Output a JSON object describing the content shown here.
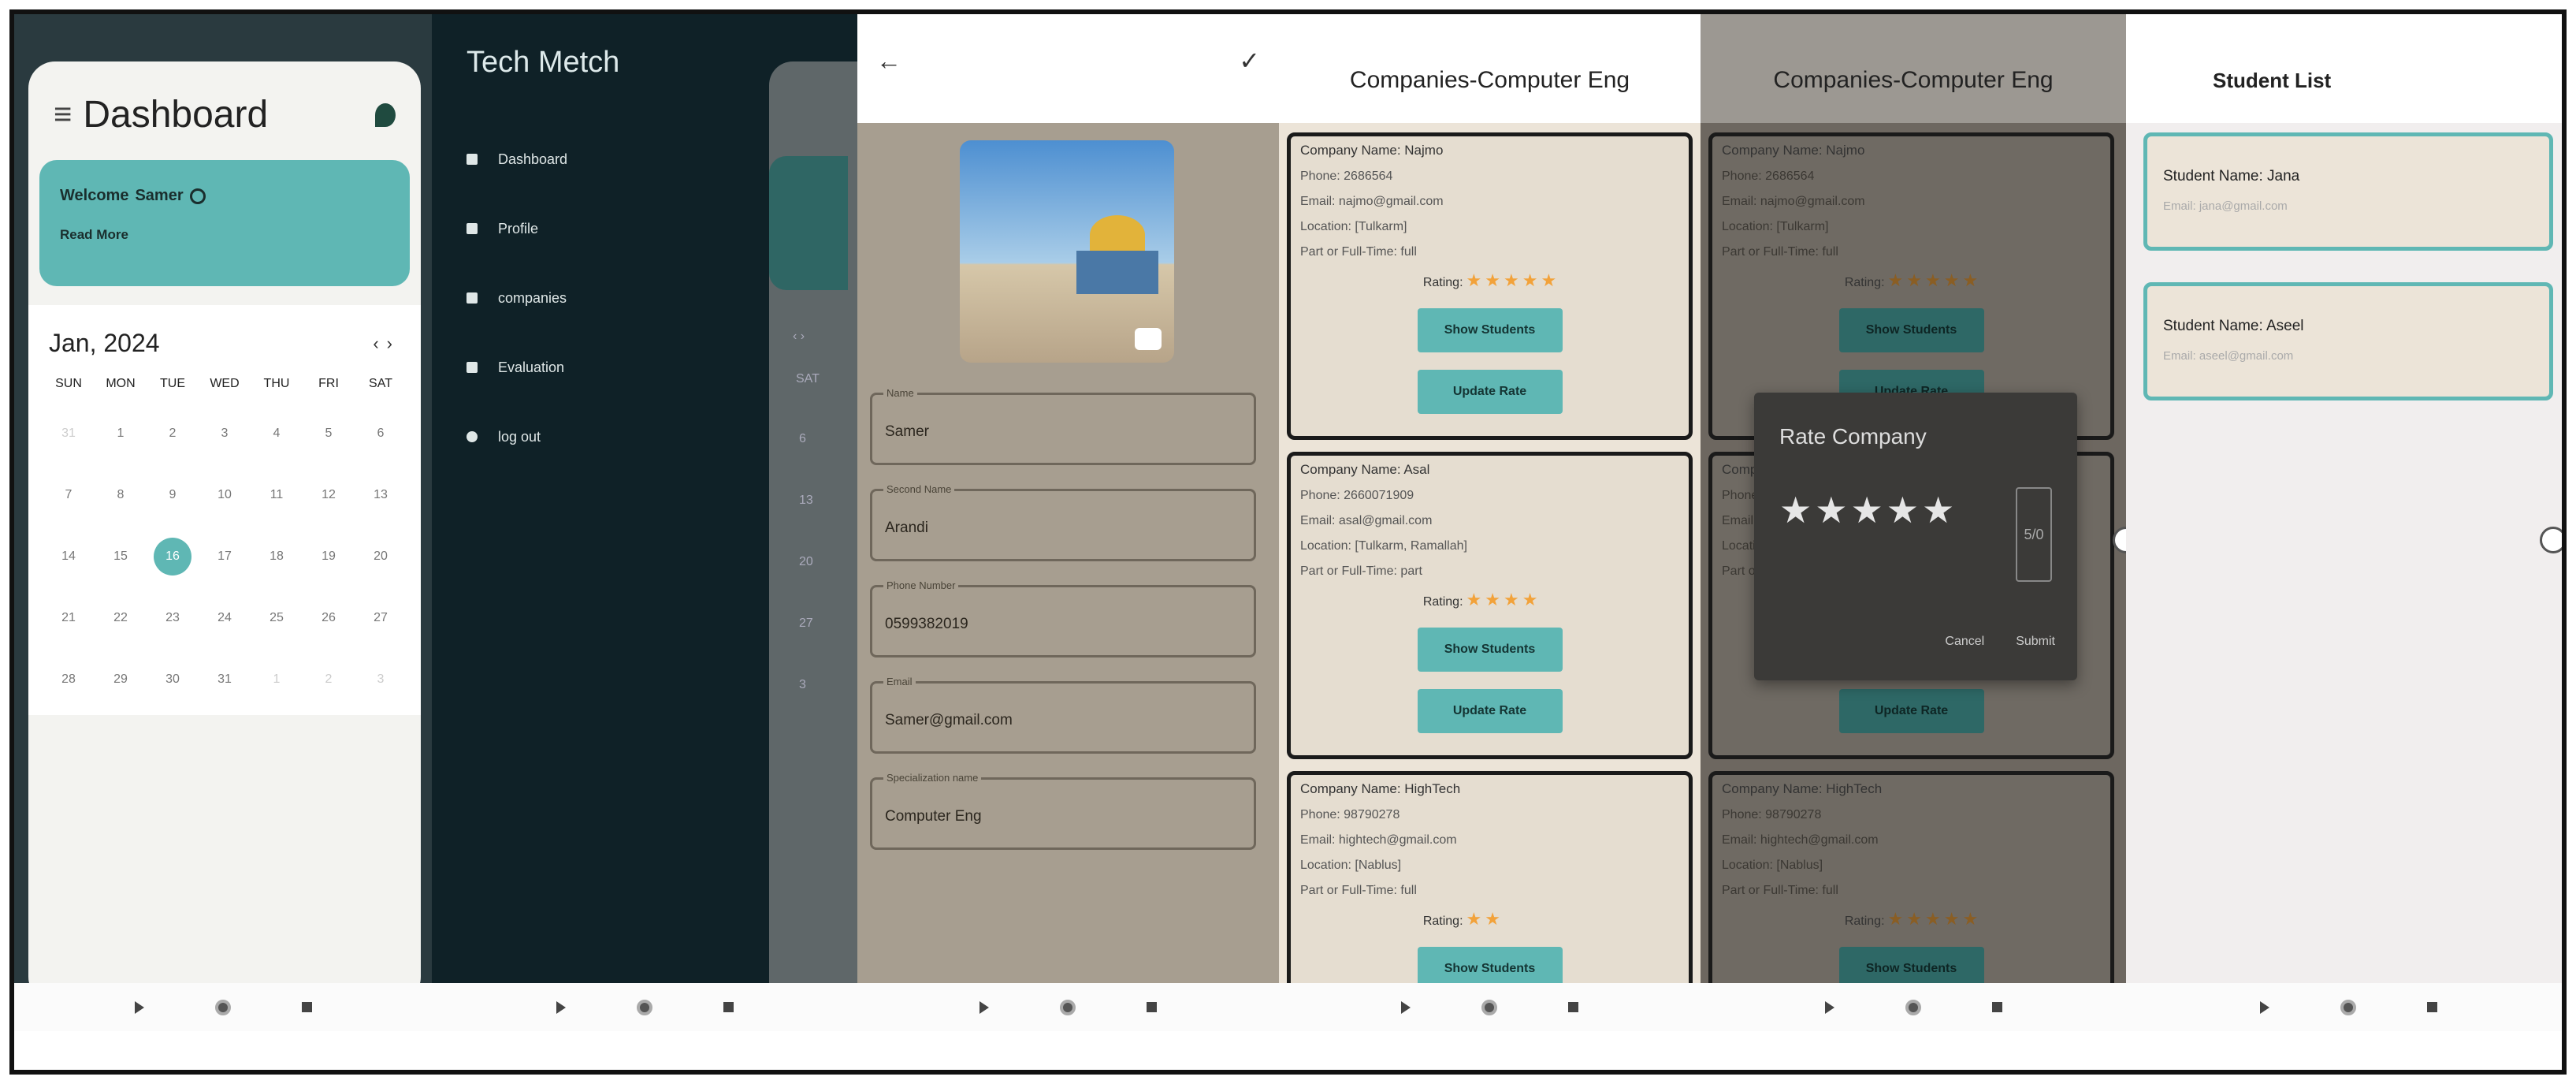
{
  "nav": {
    "back": "back-icon",
    "home": "home-icon",
    "recent": "recent-icon"
  },
  "dashboard": {
    "title": "Dashboard",
    "welcome": "Welcome ",
    "username": "Samer",
    "read_more": "Read More",
    "calendar": {
      "month": "Jan, 2024",
      "dow": [
        "SUN",
        "MON",
        "TUE",
        "WED",
        "THU",
        "FRI",
        "SAT"
      ],
      "weeks": [
        [
          {
            "d": "31",
            "m": true
          },
          {
            "d": "1"
          },
          {
            "d": "2"
          },
          {
            "d": "3"
          },
          {
            "d": "4"
          },
          {
            "d": "5"
          },
          {
            "d": "6"
          }
        ],
        [
          {
            "d": "7"
          },
          {
            "d": "8"
          },
          {
            "d": "9"
          },
          {
            "d": "10"
          },
          {
            "d": "11"
          },
          {
            "d": "12"
          },
          {
            "d": "13"
          }
        ],
        [
          {
            "d": "14"
          },
          {
            "d": "15"
          },
          {
            "d": "16",
            "t": true
          },
          {
            "d": "17"
          },
          {
            "d": "18"
          },
          {
            "d": "19"
          },
          {
            "d": "20"
          }
        ],
        [
          {
            "d": "21"
          },
          {
            "d": "22"
          },
          {
            "d": "23"
          },
          {
            "d": "24"
          },
          {
            "d": "25"
          },
          {
            "d": "26"
          },
          {
            "d": "27"
          }
        ],
        [
          {
            "d": "28"
          },
          {
            "d": "29"
          },
          {
            "d": "30"
          },
          {
            "d": "31"
          },
          {
            "d": "1",
            "m": true
          },
          {
            "d": "2",
            "m": true
          },
          {
            "d": "3",
            "m": true
          }
        ]
      ]
    }
  },
  "drawer": {
    "title": "Tech Metch",
    "items": [
      {
        "label": "Dashboard",
        "icon": "dashboard-icon"
      },
      {
        "label": "Profile",
        "icon": "person-icon"
      },
      {
        "label": "companies",
        "icon": "companies-icon"
      },
      {
        "label": "Evaluation",
        "icon": "evaluation-icon"
      },
      {
        "label": "log out",
        "icon": "logout-icon"
      }
    ],
    "scrim_sat": "SAT",
    "scrim_days": [
      "6",
      "13",
      "20",
      "27",
      "3"
    ]
  },
  "profile": {
    "back_icon": "arrow-left-icon",
    "save_icon": "check-icon",
    "fields": [
      {
        "label": "Name",
        "value": "Samer"
      },
      {
        "label": "Second Name",
        "value": "Arandi"
      },
      {
        "label": "Phone Number",
        "value": "0599382019"
      },
      {
        "label": "Email",
        "value": "Samer@gmail.com"
      },
      {
        "label": "Specialization name",
        "value": "Computer Eng"
      }
    ]
  },
  "companies": {
    "title": "Companies-Computer Eng",
    "rating_label": "Rating:",
    "show_students": "Show Students",
    "update_rate": "Update Rate",
    "list": [
      {
        "name": "Company Name: Najmo",
        "phone": "Phone: 2686564",
        "email": "Email: najmo@gmail.com",
        "location": "Location: [Tulkarm]",
        "type": "Part or Full-Time: full",
        "rating": 5
      },
      {
        "name": "Company Name: Asal",
        "phone": "Phone: 2660071909",
        "email": "Email: asal@gmail.com",
        "location": "Location: [Tulkarm, Ramallah]",
        "type": "Part or Full-Time: part",
        "rating": 4
      },
      {
        "name": "Company Name: HighTech",
        "phone": "Phone: 98790278",
        "email": "Email: hightech@gmail.com",
        "location": "Location: [Nablus]",
        "type": "Part or Full-Time: full",
        "rating": 2
      }
    ]
  },
  "rate_dialog": {
    "title": "Rate Company",
    "stars": 5,
    "counter": "5/0",
    "cancel": "Cancel",
    "submit": "Submit"
  },
  "students": {
    "title": "Student List",
    "list": [
      {
        "name": "Student Name: Jana",
        "email": "Email: jana@gmail.com"
      },
      {
        "name": "Student Name: Aseel",
        "email": "Email: aseel@gmail.com"
      }
    ]
  },
  "colors": {
    "accent": "#5fb7b4",
    "dark": "#0f2127",
    "card": "#e5ddd0",
    "star": "#f2a23a"
  }
}
